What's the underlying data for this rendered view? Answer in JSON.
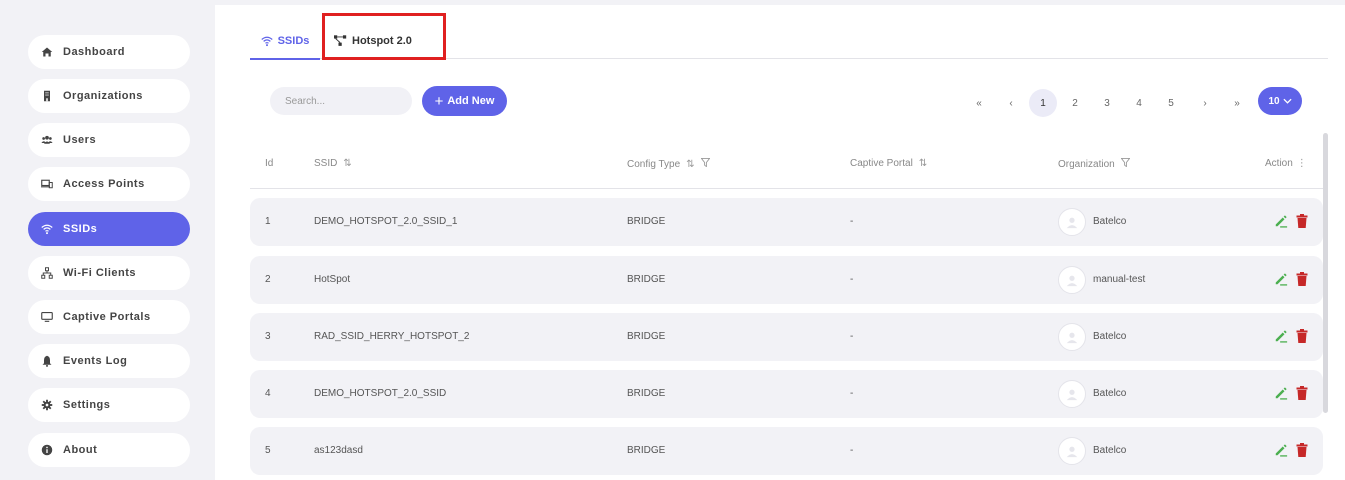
{
  "sidebar": {
    "items": [
      {
        "label": "Dashboard",
        "icon": "home-icon"
      },
      {
        "label": "Organizations",
        "icon": "building-icon"
      },
      {
        "label": "Users",
        "icon": "users-icon"
      },
      {
        "label": "Access Points",
        "icon": "devices-icon"
      },
      {
        "label": "SSIDs",
        "icon": "wifi-icon",
        "active": true
      },
      {
        "label": "Wi-Fi Clients",
        "icon": "network-icon"
      },
      {
        "label": "Captive Portals",
        "icon": "monitor-icon"
      },
      {
        "label": "Events Log",
        "icon": "bell-icon"
      },
      {
        "label": "Settings",
        "icon": "gear-icon"
      },
      {
        "label": "About",
        "icon": "info-icon"
      }
    ]
  },
  "tabs": [
    {
      "label": "SSIDs",
      "icon": "wifi-icon",
      "active": true
    },
    {
      "label": "Hotspot 2.0",
      "icon": "hierarchy-icon"
    }
  ],
  "toolbar": {
    "search_placeholder": "Search...",
    "add_label": "Add New"
  },
  "pagination": {
    "first": "«",
    "prev": "‹",
    "pages": [
      "1",
      "2",
      "3",
      "4",
      "5"
    ],
    "current": "1",
    "next": "›",
    "last": "»",
    "per_page": "10"
  },
  "table": {
    "columns": {
      "id": "Id",
      "ssid": "SSID",
      "config_type": "Config Type",
      "captive_portal": "Captive Portal",
      "organization": "Organization",
      "action": "Action"
    },
    "rows": [
      {
        "id": "1",
        "ssid": "DEMO_HOTSPOT_2.0_SSID_1",
        "config_type": "BRIDGE",
        "captive_portal": "-",
        "organization": "Batelco"
      },
      {
        "id": "2",
        "ssid": "HotSpot",
        "config_type": "BRIDGE",
        "captive_portal": "-",
        "organization": "manual-test"
      },
      {
        "id": "3",
        "ssid": "RAD_SSID_HERRY_HOTSPOT_2",
        "config_type": "BRIDGE",
        "captive_portal": "-",
        "organization": "Batelco"
      },
      {
        "id": "4",
        "ssid": "DEMO_HOTSPOT_2.0_SSID",
        "config_type": "BRIDGE",
        "captive_portal": "-",
        "organization": "Batelco"
      },
      {
        "id": "5",
        "ssid": "as123dasd",
        "config_type": "BRIDGE",
        "captive_portal": "-",
        "organization": "Batelco"
      }
    ]
  },
  "colors": {
    "accent": "#5f63e8",
    "highlight_box": "#e02020",
    "edit": "#4caf50",
    "delete": "#c62828"
  }
}
